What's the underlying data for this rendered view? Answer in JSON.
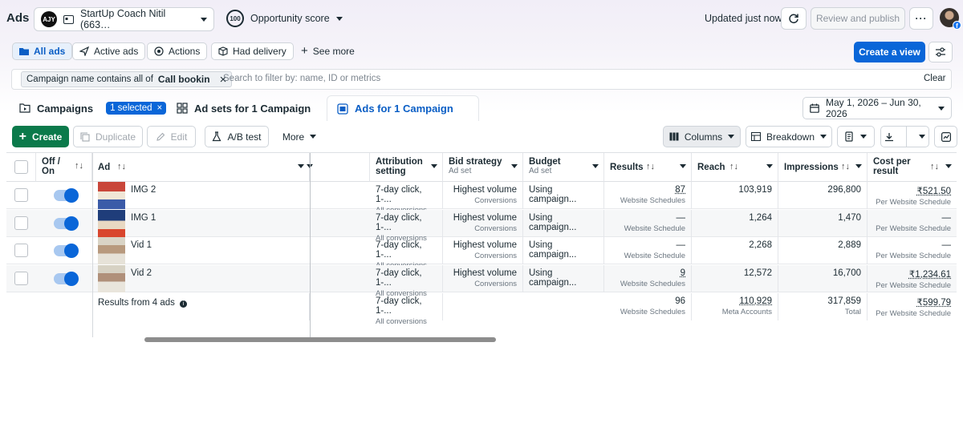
{
  "header": {
    "app_title": "Ads",
    "account_logo": "AJY",
    "account_name": "StartUp Coach Nitil (663…",
    "opportunity_score_value": "100",
    "opportunity_score_label": "Opportunity score",
    "updated_text": "Updated just now",
    "review_publish_label": "Review and publish",
    "more_label": "···"
  },
  "filters": {
    "chips": [
      "All ads",
      "Active ads",
      "Actions",
      "Had delivery"
    ],
    "see_more": "See more",
    "create_view": "Create a view"
  },
  "search": {
    "token_prefix": "Campaign name contains all of",
    "token_value": "Call bookin",
    "placeholder": "Search to filter by: name, ID or metrics",
    "clear": "Clear"
  },
  "tabs": {
    "campaigns": "Campaigns",
    "selected_badge": "1 selected",
    "adsets": "Ad sets for 1 Campaign",
    "ads": "Ads for 1 Campaign"
  },
  "date_range": "May 1, 2026 – Jun 30, 2026",
  "toolbar": {
    "create": "Create",
    "duplicate": "Duplicate",
    "edit": "Edit",
    "ab_test": "A/B test",
    "more": "More",
    "columns": "Columns",
    "breakdown": "Breakdown"
  },
  "table": {
    "headers": {
      "off_on": "Off / On",
      "ad": "Ad",
      "attribution": "Attribution setting",
      "bid": "Bid strategy",
      "bid_sub": "Ad set",
      "budget": "Budget",
      "budget_sub": "Ad set",
      "results": "Results",
      "reach": "Reach",
      "impressions": "Impressions",
      "cost": "Cost per result"
    },
    "rows": [
      {
        "name": "IMG 2",
        "attribution": "7-day click, 1-...",
        "attribution_sub": "All conversions",
        "bid": "Highest volume",
        "bid_sub": "Conversions",
        "budget": "Using campaign...",
        "results": "87",
        "results_sub": "Website Schedules",
        "reach": "103,919",
        "impressions": "296,800",
        "cost": "₹521.50",
        "cost_sub": "Per Website Schedule"
      },
      {
        "name": "IMG 1",
        "attribution": "7-day click, 1-...",
        "attribution_sub": "All conversions",
        "bid": "Highest volume",
        "bid_sub": "Conversions",
        "budget": "Using campaign...",
        "results": "—",
        "results_sub": "Website Schedule",
        "reach": "1,264",
        "impressions": "1,470",
        "cost": "—",
        "cost_sub": "Per Website Schedule"
      },
      {
        "name": "Vid 1",
        "attribution": "7-day click, 1-...",
        "attribution_sub": "All conversions",
        "bid": "Highest volume",
        "bid_sub": "Conversions",
        "budget": "Using campaign...",
        "results": "—",
        "results_sub": "Website Schedule",
        "reach": "2,268",
        "impressions": "2,889",
        "cost": "—",
        "cost_sub": "Per Website Schedule"
      },
      {
        "name": "Vid 2",
        "attribution": "7-day click, 1-...",
        "attribution_sub": "All conversions",
        "bid": "Highest volume",
        "bid_sub": "Conversions",
        "budget": "Using campaign...",
        "results": "9",
        "results_sub": "Website Schedules",
        "reach": "12,572",
        "impressions": "16,700",
        "cost": "₹1,234.61",
        "cost_sub": "Per Website Schedule"
      }
    ],
    "summary": {
      "label": "Results from 4 ads",
      "attribution": "7-day click, 1-...",
      "attribution_sub": "All conversions",
      "results": "96",
      "results_sub": "Website Schedules",
      "reach": "110,929",
      "reach_sub": "Meta Accounts",
      "impressions": "317,859",
      "impressions_sub": "Total",
      "cost": "₹599.79",
      "cost_sub": "Per Website Schedule"
    }
  },
  "colors": {
    "primary_blue": "#0a66d8",
    "create_green": "#0b7a4b",
    "toggle_on": "#0a66d8"
  }
}
